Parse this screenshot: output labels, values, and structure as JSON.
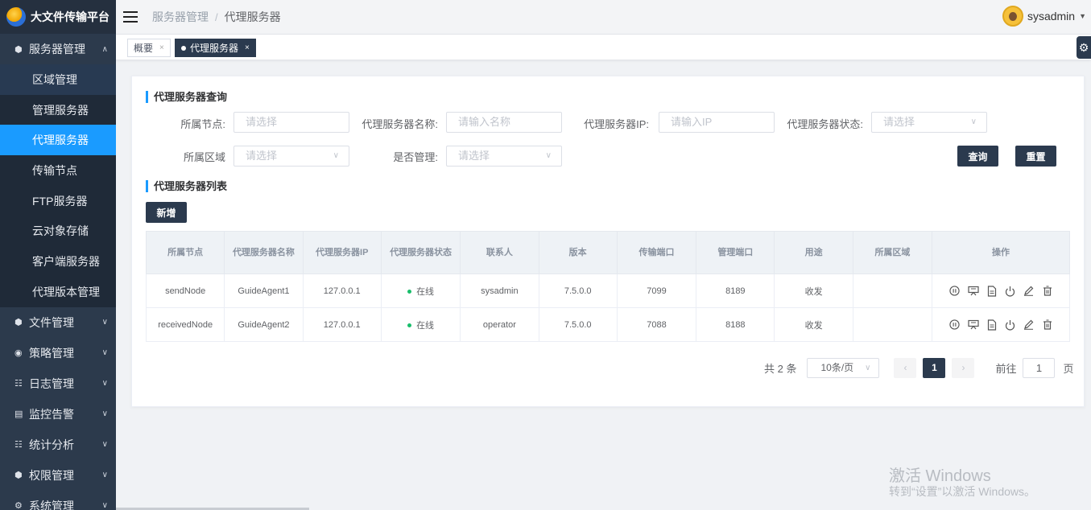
{
  "app": {
    "title": "大文件传输平台"
  },
  "sidebar": {
    "groups": [
      {
        "label": "服务器管理",
        "icon": "cube-icon",
        "expanded": true
      },
      {
        "label": "文件管理",
        "icon": "cube-icon"
      },
      {
        "label": "策略管理",
        "icon": "shield-icon"
      },
      {
        "label": "日志管理",
        "icon": "grid-icon"
      },
      {
        "label": "监控告警",
        "icon": "monitor-icon"
      },
      {
        "label": "统计分析",
        "icon": "grid-icon"
      },
      {
        "label": "权限管理",
        "icon": "cube-icon"
      },
      {
        "label": "系统管理",
        "icon": "gear-icon"
      }
    ],
    "items": [
      {
        "label": "区域管理"
      },
      {
        "label": "管理服务器"
      },
      {
        "label": "代理服务器"
      },
      {
        "label": "传输节点"
      },
      {
        "label": "FTP服务器"
      },
      {
        "label": "云对象存储"
      },
      {
        "label": "客户端服务器"
      },
      {
        "label": "代理版本管理"
      }
    ]
  },
  "header": {
    "breadcrumb": [
      "服务器管理",
      "代理服务器"
    ],
    "breadcrumb_sep": "/",
    "username": "sysadmin"
  },
  "tabs": [
    {
      "label": "概要"
    },
    {
      "label": "代理服务器"
    }
  ],
  "query": {
    "title": "代理服务器查询",
    "fields": {
      "node": {
        "label": "所属节点:",
        "placeholder": "请选择"
      },
      "name": {
        "label": "代理服务器名称:",
        "placeholder": "请输入名称"
      },
      "ip": {
        "label": "代理服务器IP:",
        "placeholder": "请输入IP"
      },
      "status": {
        "label": "代理服务器状态:",
        "placeholder": "请选择"
      },
      "region": {
        "label": "所属区域",
        "placeholder": "请选择"
      },
      "managed": {
        "label": "是否管理:",
        "placeholder": "请选择"
      }
    },
    "search_label": "查询",
    "reset_label": "重置"
  },
  "list": {
    "title": "代理服务器列表",
    "add_label": "新增",
    "columns": [
      "所属节点",
      "代理服务器名称",
      "代理服务器IP",
      "代理服务器状态",
      "联系人",
      "版本",
      "传输端口",
      "管理端口",
      "用途",
      "所属区域",
      "操作"
    ],
    "rows": [
      {
        "node": "sendNode",
        "name": "GuideAgent1",
        "ip": "127.0.0.1",
        "status": "在线",
        "contact": "sysadmin",
        "version": "7.5.0.0",
        "transfer_port": "7099",
        "manage_port": "8189",
        "usage": "收发",
        "region": ""
      },
      {
        "node": "receivedNode",
        "name": "GuideAgent2",
        "ip": "127.0.0.1",
        "status": "在线",
        "contact": "operator",
        "version": "7.5.0.0",
        "transfer_port": "7088",
        "manage_port": "8188",
        "usage": "收发",
        "region": ""
      }
    ],
    "status_color": "#19be6b"
  },
  "pagination": {
    "total": "共 2 条",
    "page_size": "10条/页",
    "current_page": "1",
    "goto_label": "前往",
    "goto_value": "1",
    "page_suffix": "页"
  },
  "watermark": {
    "line1": "激活 Windows",
    "line2": "转到“设置”以激活 Windows。"
  },
  "colors": {
    "sidebar_bg": "#2c3a4c",
    "accent": "#1a9bff",
    "button_dark": "#2b3a4e"
  }
}
